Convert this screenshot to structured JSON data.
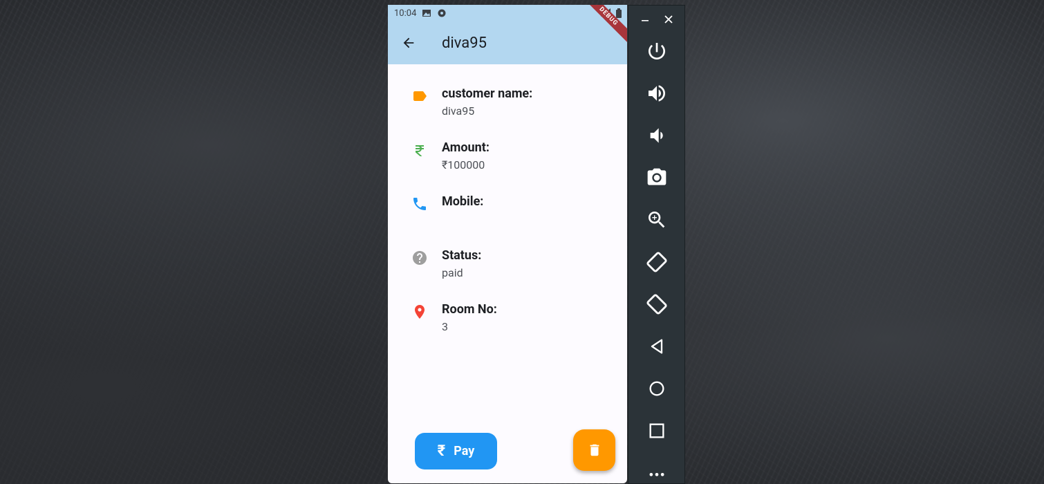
{
  "statusbar": {
    "time": "10:04"
  },
  "appbar": {
    "title": "diva95",
    "debug_label": "DEBUG"
  },
  "details": [
    {
      "label": "customer name:",
      "value": "diva95",
      "icon": "label-icon",
      "color": "#ff9800"
    },
    {
      "label": "Amount:",
      "value": "₹100000",
      "icon": "rupee-icon",
      "color": "#4caf50"
    },
    {
      "label": "Mobile:",
      "value": "",
      "icon": "phone-icon",
      "color": "#2196f3"
    },
    {
      "label": "Status:",
      "value": "paid",
      "icon": "help-icon",
      "color": "#9e9e9e"
    },
    {
      "label": "Room No:",
      "value": "3",
      "icon": "location-pin-icon",
      "color": "#f44336"
    }
  ],
  "actions": {
    "pay_label": "Pay",
    "pay_symbol": "₹"
  },
  "emulator_controls": [
    "power",
    "volume-up",
    "volume-down",
    "screenshot",
    "zoom",
    "rotate-left",
    "rotate-right",
    "back",
    "home",
    "overview",
    "more"
  ],
  "colors": {
    "appbar": "#b3d7f0",
    "primary": "#2196f3",
    "fab": "#ff9800"
  }
}
